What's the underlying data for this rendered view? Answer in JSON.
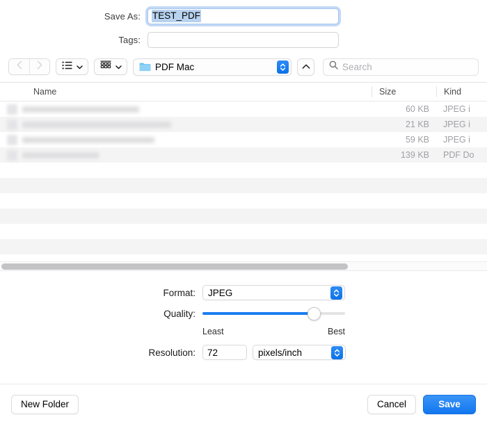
{
  "form": {
    "save_as_label": "Save As:",
    "save_as_value": "TEST_PDF",
    "tags_label": "Tags:",
    "tags_value": ""
  },
  "toolbar": {
    "back_icon": "chevron-left-icon",
    "forward_icon": "chevron-right-icon",
    "list_view_icon": "list-view-icon",
    "icon_view_icon": "grid-view-icon",
    "path_label": "PDF Mac",
    "path_icon": "folder-icon",
    "up_icon": "chevron-up-icon",
    "search_icon": "search-icon",
    "search_placeholder": "Search",
    "search_value": ""
  },
  "file_list": {
    "columns": [
      "Name",
      "Size",
      "Kind"
    ],
    "rows": [
      {
        "name": "",
        "size": "60 KB",
        "kind": "JPEG i"
      },
      {
        "name": "",
        "size": "21 KB",
        "kind": "JPEG i"
      },
      {
        "name": "",
        "size": "59 KB",
        "kind": "JPEG i"
      },
      {
        "name": "",
        "size": "139 KB",
        "kind": "PDF Do"
      }
    ],
    "empty_row_count": 8
  },
  "options": {
    "format_label": "Format:",
    "format_value": "JPEG",
    "quality_label": "Quality:",
    "quality_least_label": "Least",
    "quality_best_label": "Best",
    "quality_percent": 81,
    "resolution_label": "Resolution:",
    "resolution_value": "72",
    "resolution_unit": "pixels/inch"
  },
  "footer": {
    "new_folder_label": "New Folder",
    "cancel_label": "Cancel",
    "save_label": "Save"
  },
  "colors": {
    "accent": "#1277ef",
    "selection": "#b8d2f0",
    "stripe": "#f4f4f5"
  }
}
